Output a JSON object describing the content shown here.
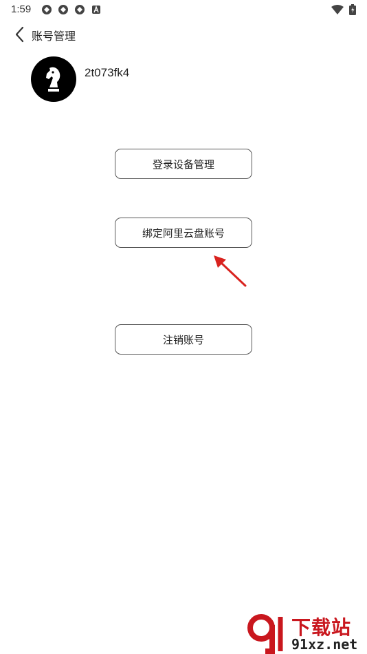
{
  "status_bar": {
    "time": "1:59",
    "left_icons": [
      "sync-icon",
      "sync-icon",
      "sync-icon",
      "a-badge-icon"
    ],
    "right_icons": [
      "wifi-icon",
      "battery-icon"
    ]
  },
  "header": {
    "title": "账号管理"
  },
  "profile": {
    "username": "2t073fk4",
    "avatar_icon": "chess-knight-icon"
  },
  "actions": {
    "device_login": "登录设备管理",
    "bind_aliyun": "绑定阿里云盘账号",
    "deregister": "注销账号"
  },
  "annotation": {
    "arrow_color": "#d9231f"
  },
  "watermark": {
    "top_text": "下载站",
    "bottom_text": "91xz.net"
  }
}
